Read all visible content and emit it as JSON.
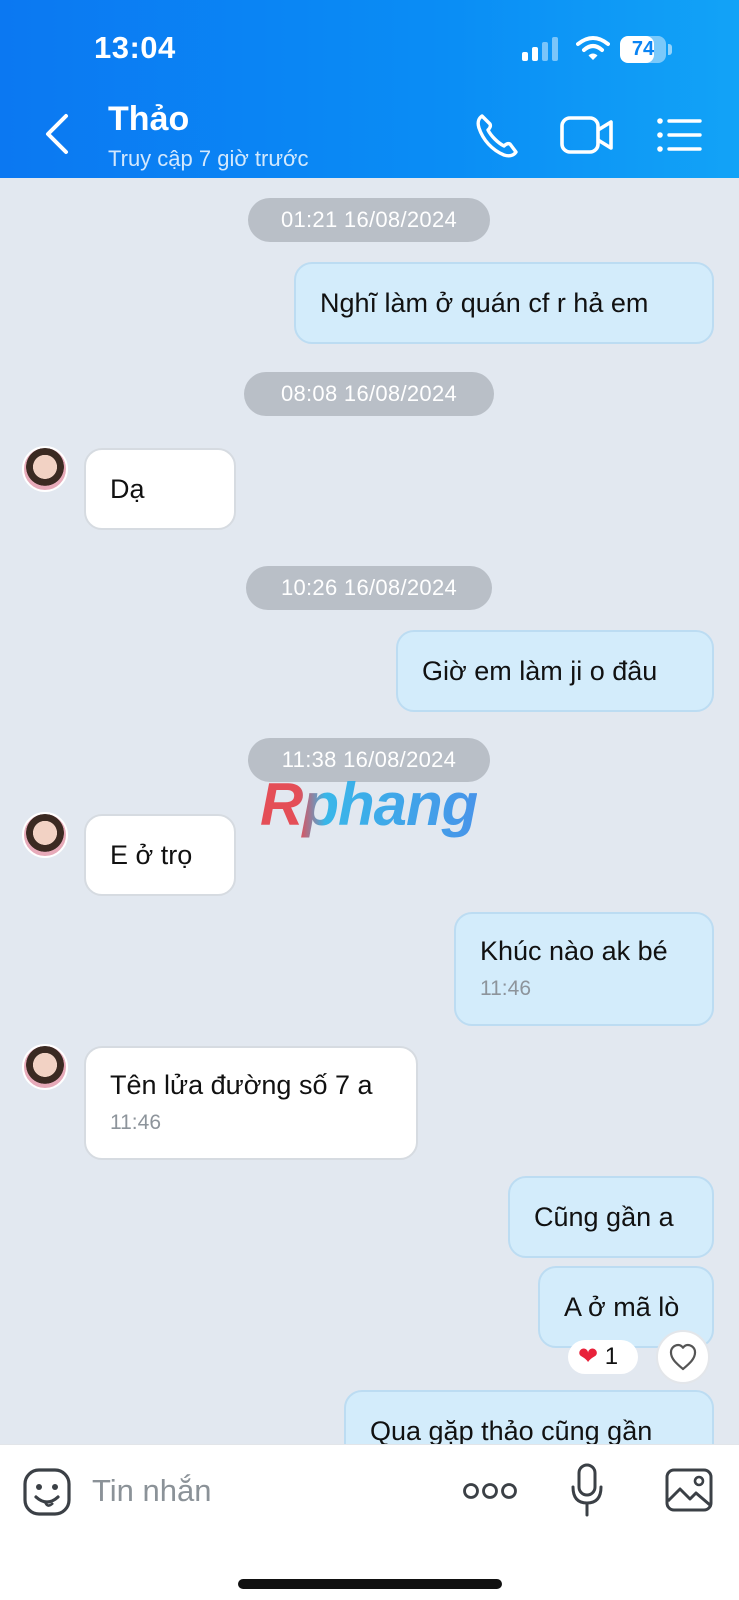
{
  "status_bar": {
    "time": "13:04",
    "battery": "74",
    "battery_level": 0.74
  },
  "header": {
    "title": "Thảo",
    "subtitle": "Truy cập 7 giờ trước"
  },
  "messages": {
    "ts1": "01:21 16/08/2024",
    "m1": "Nghĩ làm ở quán cf r hả em",
    "ts2": "08:08 16/08/2024",
    "m2": "Dạ",
    "ts3": "10:26 16/08/2024",
    "m3": "Giờ em  làm ji o đâu",
    "ts4": "11:38 16/08/2024",
    "m4": "E ở trọ",
    "m5": {
      "text": "Khúc nào ak bé",
      "time": "11:46"
    },
    "m6": {
      "text": "Tên lửa đường số 7 a",
      "time": "11:46"
    },
    "m7": "Cũng gần a",
    "m8": "A ở mã lò",
    "m8_reaction_count": "1",
    "m9": "Qua gặp thảo cũng gần"
  },
  "watermark": "Rphang",
  "composer": {
    "placeholder": "Tin nhắn"
  },
  "icons": {
    "back": "chevron-left-icon",
    "call": "phone-icon",
    "video": "video-icon",
    "menu": "list-icon",
    "emoji": "sticker-icon",
    "more": "more-icon",
    "mic": "microphone-icon",
    "image": "image-icon",
    "heart": "heart-icon"
  },
  "colors": {
    "header_start": "#0b78f2",
    "header_end": "#12a3f7",
    "my_bubble": "#d3ecfb",
    "their_bubble": "#ffffff",
    "background": "#e2e8f0",
    "timestamp_pill": "#b9bfc7"
  }
}
